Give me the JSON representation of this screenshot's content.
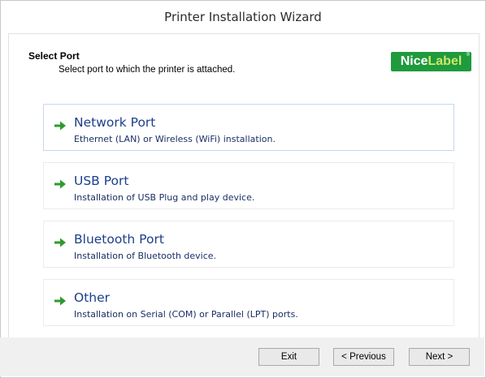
{
  "window": {
    "title": "Printer Installation Wizard"
  },
  "header": {
    "title": "Select Port",
    "subtitle": "Select port to which the printer is attached.",
    "logo": {
      "part1": "Nice",
      "part2": "Label",
      "registered": "®",
      "color": "#1f9a3c",
      "accent": "#cbe86b"
    }
  },
  "options": [
    {
      "title": "Network Port",
      "description": "Ethernet (LAN) or Wireless (WiFi) installation.",
      "icon": "green-arrow-icon",
      "selected": true
    },
    {
      "title": "USB Port",
      "description": "Installation of USB Plug and play device.",
      "icon": "green-arrow-icon",
      "selected": false
    },
    {
      "title": "Bluetooth Port",
      "description": "Installation of Bluetooth device.",
      "icon": "green-arrow-icon",
      "selected": false
    },
    {
      "title": "Other",
      "description": "Installation on Serial (COM) or Parallel (LPT) ports.",
      "icon": "green-arrow-icon",
      "selected": false
    }
  ],
  "footer": {
    "exit_label": "Exit",
    "previous_label": "< Previous",
    "next_label": "Next >"
  },
  "colors": {
    "option_title": "#1c3f8a",
    "arrow_green": "#2e9a2e",
    "footer_bg": "#f0f0f0"
  }
}
